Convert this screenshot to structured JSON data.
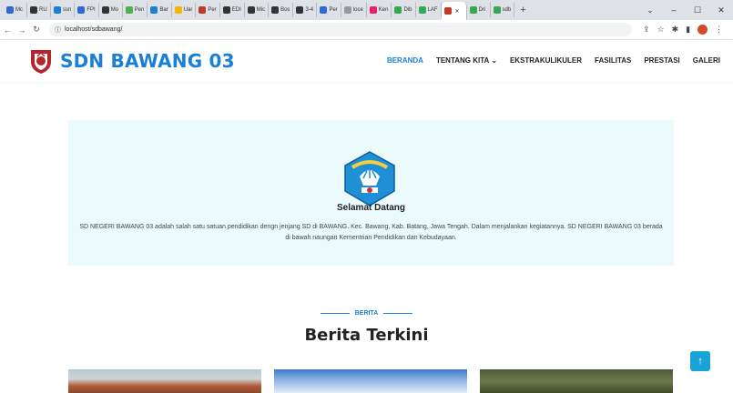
{
  "browser": {
    "tabs": [
      {
        "label": "Mc",
        "color": "#2d6ad6"
      },
      {
        "label": "RU",
        "color": "#333333"
      },
      {
        "label": "ssn",
        "color": "#1a7fd6"
      },
      {
        "label": "FPI",
        "color": "#2d6ad6"
      },
      {
        "label": "Mo",
        "color": "#333333"
      },
      {
        "label": "Pen",
        "color": "#4caf50"
      },
      {
        "label": "Bar",
        "color": "#1a7fd6"
      },
      {
        "label": "Uar",
        "color": "#f2b705"
      },
      {
        "label": "Per",
        "color": "#c0392b"
      },
      {
        "label": "EDI",
        "color": "#333333"
      },
      {
        "label": "Mic",
        "color": "#333333"
      },
      {
        "label": "Bos",
        "color": "#333333"
      },
      {
        "label": "3-4",
        "color": "#333333"
      },
      {
        "label": "Per",
        "color": "#2d6ad6"
      },
      {
        "label": "loce",
        "color": "#999999"
      },
      {
        "label": "Ken",
        "color": "#e91e63"
      },
      {
        "label": "Dib",
        "color": "#34a853"
      },
      {
        "label": "LAF",
        "color": "#34a853"
      },
      {
        "label": "",
        "color": "#c0392b",
        "active": true
      },
      {
        "label": "Dri",
        "color": "#34a853"
      },
      {
        "label": "sdb",
        "color": "#34a853"
      }
    ],
    "new_tab": "+",
    "window_controls": {
      "minimize": "–",
      "maximize": "☐",
      "close": "✕",
      "dropdown": "⌄"
    },
    "url": "localhost/sdbawang/"
  },
  "site": {
    "brand": "SDN BAWANG 03",
    "nav": [
      "BERANDA",
      "TENTANG KITA ⌄",
      "EKSTRAKULIKULER",
      "FASILITAS",
      "PRESTASI",
      "GALERI"
    ]
  },
  "welcome": {
    "title": "Selamat Datang",
    "text": "SD NEGERI BAWANG 03 adalah salah satu satuan pendidikan dengn jenjang SD di BAWANG. Kec. Bawang, Kab. Batang, Jawa Tengah. Dalam menjalankan kegiatannya. SD NEGERI BAWANG 03 berada di bawah naungan Kementrian Pendidikan dan Kebudayaan."
  },
  "news": {
    "kicker": "BERITA",
    "title": "Berita Terkini"
  },
  "back_to_top": "↑",
  "colors": {
    "accent": "#1a7fd6",
    "welcome_bg": "#ebfbfb",
    "back_to_top": "#1aa3d6"
  }
}
